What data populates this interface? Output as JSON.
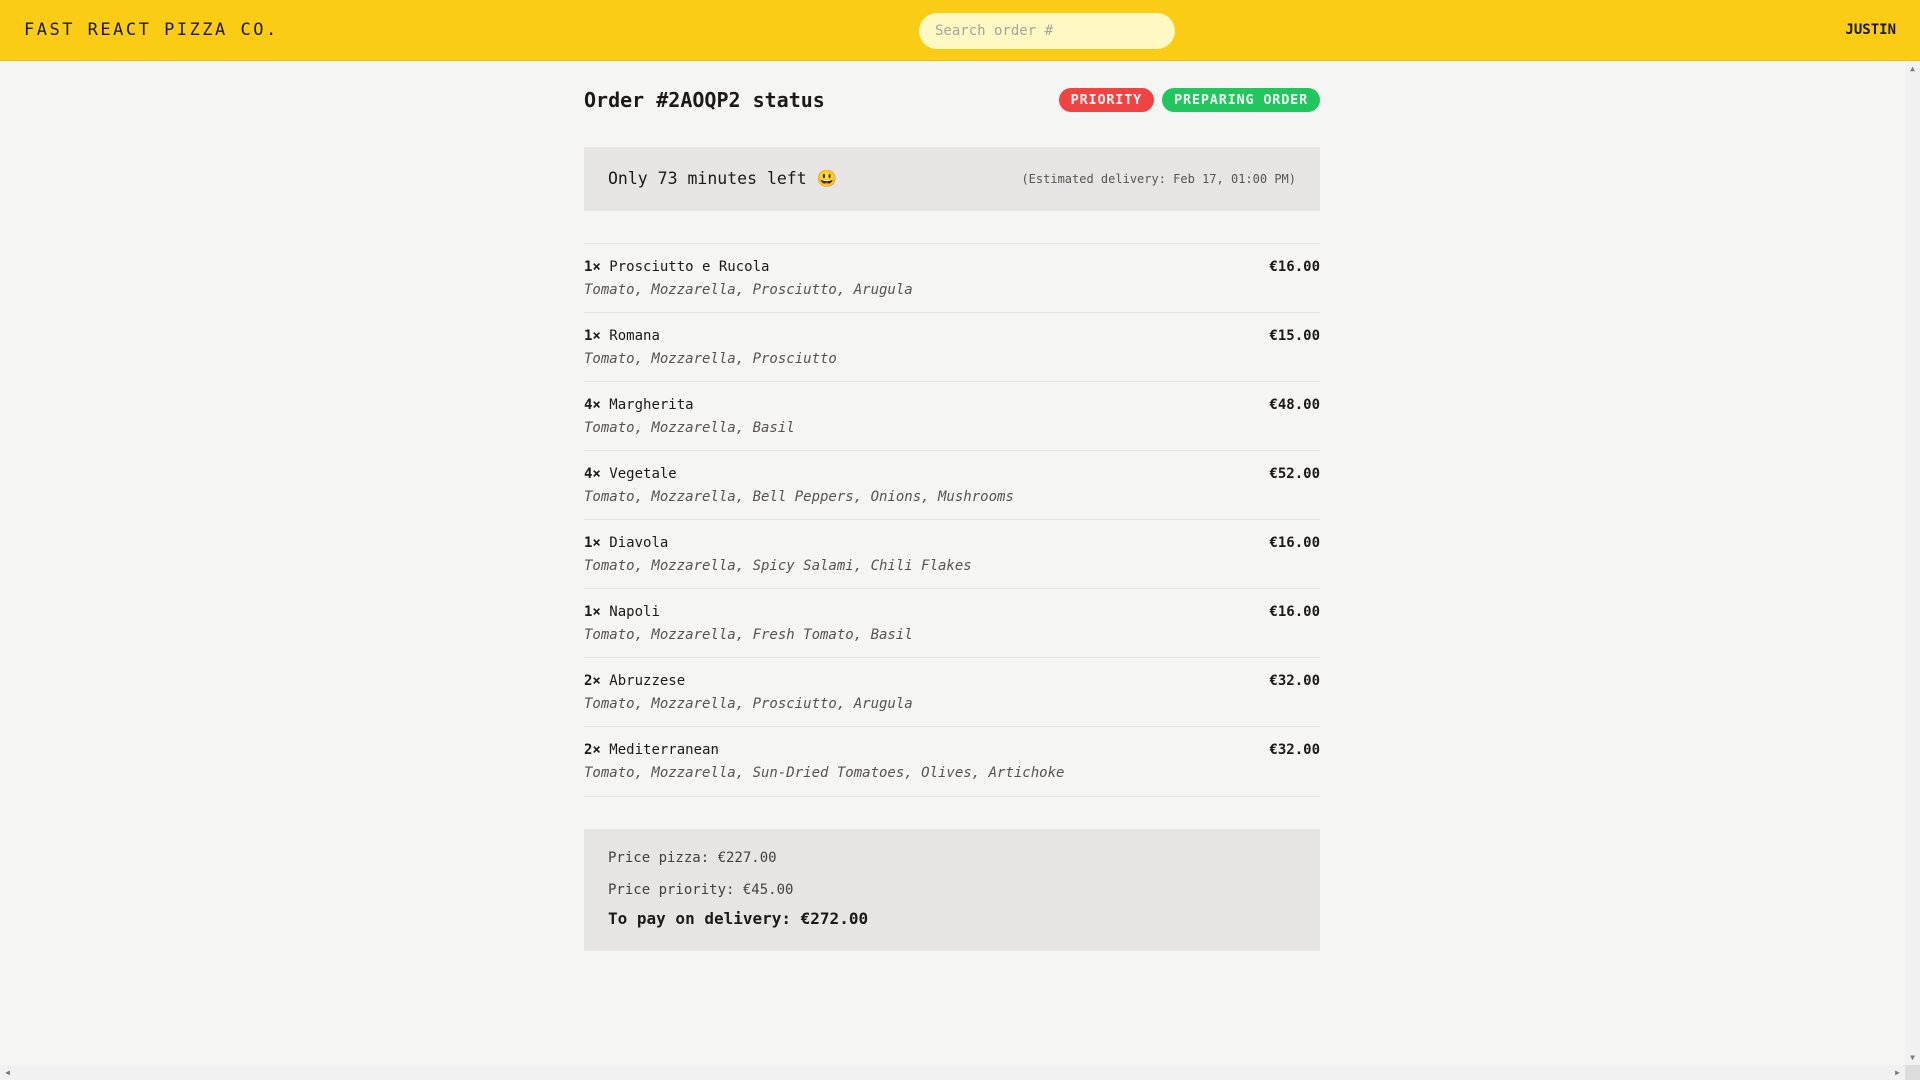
{
  "header": {
    "logo": "Fast React Pizza Co.",
    "search_placeholder": "Search order #",
    "username": "Justin"
  },
  "order": {
    "title": "Order #2AOQP2 status",
    "badges": {
      "priority": "Priority",
      "status": "Preparing order"
    },
    "countdown": "Only 73 minutes left 😃",
    "estimate": "(Estimated delivery: Feb 17, 01:00 PM)",
    "items": [
      {
        "qty": "1×",
        "name": "Prosciutto e Rucola",
        "price": "€16.00",
        "ingredients": "Tomato, Mozzarella, Prosciutto, Arugula"
      },
      {
        "qty": "1×",
        "name": "Romana",
        "price": "€15.00",
        "ingredients": "Tomato, Mozzarella, Prosciutto"
      },
      {
        "qty": "4×",
        "name": "Margherita",
        "price": "€48.00",
        "ingredients": "Tomato, Mozzarella, Basil"
      },
      {
        "qty": "4×",
        "name": "Vegetale",
        "price": "€52.00",
        "ingredients": "Tomato, Mozzarella, Bell Peppers, Onions, Mushrooms"
      },
      {
        "qty": "1×",
        "name": "Diavola",
        "price": "€16.00",
        "ingredients": "Tomato, Mozzarella, Spicy Salami, Chili Flakes"
      },
      {
        "qty": "1×",
        "name": "Napoli",
        "price": "€16.00",
        "ingredients": "Tomato, Mozzarella, Fresh Tomato, Basil"
      },
      {
        "qty": "2×",
        "name": "Abruzzese",
        "price": "€32.00",
        "ingredients": "Tomato, Mozzarella, Prosciutto, Arugula"
      },
      {
        "qty": "2×",
        "name": "Mediterranean",
        "price": "€32.00",
        "ingredients": "Tomato, Mozzarella, Sun-Dried Tomatoes, Olives, Artichoke"
      }
    ],
    "totals": {
      "pizza": "Price pizza: €227.00",
      "priority": "Price priority: €45.00",
      "total": "To pay on delivery: €272.00"
    }
  },
  "colors": {
    "header_bg": "#facc15",
    "priority_badge": "#ef4444",
    "status_badge": "#22c55e",
    "panel_bg": "#e7e5e4",
    "page_bg": "#f5f5f4"
  },
  "icons": {
    "scroll_up": "▲",
    "scroll_down": "▼",
    "scroll_left": "◀",
    "scroll_right": "▶"
  }
}
